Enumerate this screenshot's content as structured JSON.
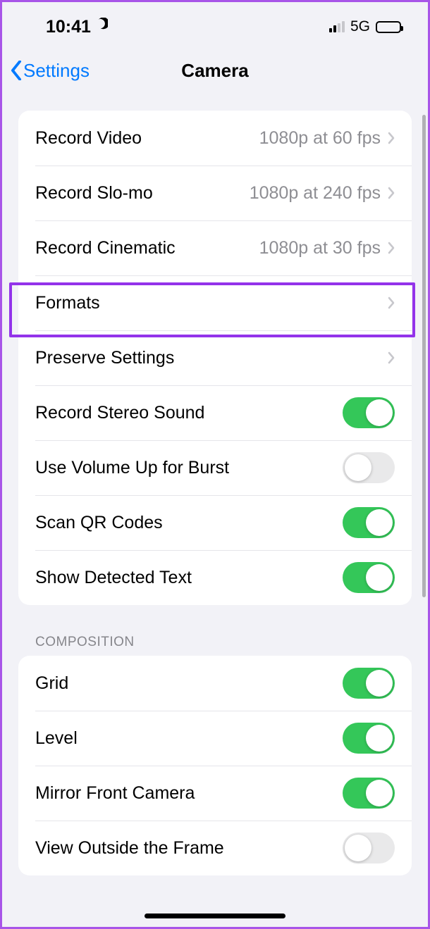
{
  "status": {
    "time": "10:41",
    "network": "5G"
  },
  "nav": {
    "back": "Settings",
    "title": "Camera"
  },
  "rows": {
    "record_video": {
      "label": "Record Video",
      "detail": "1080p at 60 fps"
    },
    "record_slomo": {
      "label": "Record Slo-mo",
      "detail": "1080p at 240 fps"
    },
    "record_cinematic": {
      "label": "Record Cinematic",
      "detail": "1080p at 30 fps"
    },
    "formats": {
      "label": "Formats"
    },
    "preserve": {
      "label": "Preserve Settings"
    },
    "stereo": {
      "label": "Record Stereo Sound",
      "on": true
    },
    "volume_burst": {
      "label": "Use Volume Up for Burst",
      "on": false
    },
    "qr": {
      "label": "Scan QR Codes",
      "on": true
    },
    "detected_text": {
      "label": "Show Detected Text",
      "on": true
    }
  },
  "section2": {
    "header": "COMPOSITION",
    "grid": {
      "label": "Grid",
      "on": true
    },
    "level": {
      "label": "Level",
      "on": true
    },
    "mirror": {
      "label": "Mirror Front Camera",
      "on": true
    },
    "view_outside": {
      "label": "View Outside the Frame",
      "on": false
    }
  }
}
